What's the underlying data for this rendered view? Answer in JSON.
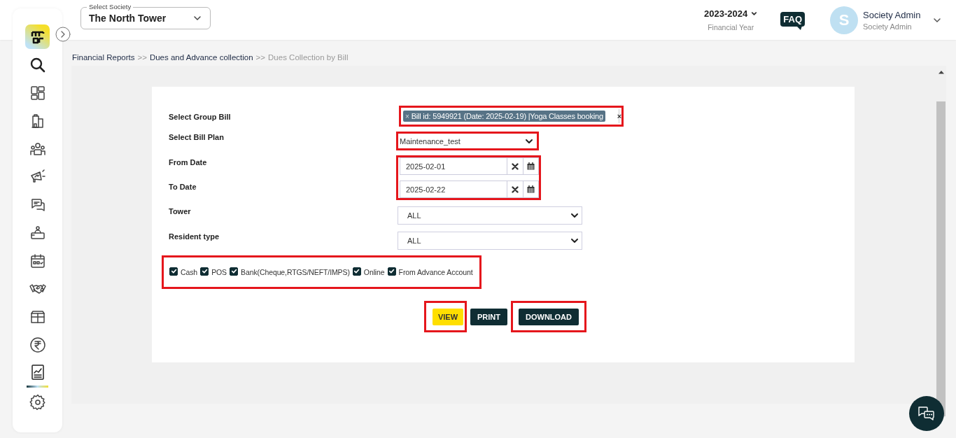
{
  "header": {
    "society_select": {
      "label": "Select Society",
      "value": "The North Tower"
    },
    "financial_year": {
      "value": "2023-2024",
      "caption": "Financial Year"
    },
    "faq": "FAQ",
    "user": {
      "initial": "S",
      "name": "Society Admin",
      "role": "Society Admin"
    }
  },
  "sidebar": {
    "items": [
      {
        "selected": false
      },
      {
        "selected": false
      },
      {
        "selected": false
      },
      {
        "selected": false
      },
      {
        "selected": false
      },
      {
        "selected": false
      },
      {
        "selected": false
      },
      {
        "selected": false
      },
      {
        "selected": false
      },
      {
        "selected": false
      },
      {
        "selected": false
      },
      {
        "selected": true
      },
      {
        "selected": false
      }
    ]
  },
  "breadcrumb": [
    {
      "label": "Financial Reports",
      "current": false
    },
    {
      "label": "Dues and Advance collection",
      "current": false
    },
    {
      "label": "Dues Collection by Bill",
      "current": true
    }
  ],
  "breadcrumb_separator": ">>",
  "form": {
    "fields": [
      {
        "kind": "tags",
        "label": "Select Group Bill",
        "tags": [
          {
            "remove": "×",
            "label": "Bill id: 5949921 (Date: 2025-02-19) |Yoga Classes booking"
          }
        ],
        "clear": "×",
        "highlighted": true
      },
      {
        "kind": "select",
        "label": "Select Bill Plan",
        "value": "Maintenance_test",
        "highlighted": true
      },
      {
        "kind": "daterange",
        "highlighted": true,
        "dates": [
          {
            "label": "From Date",
            "value": "2025-02-01"
          },
          {
            "label": "To Date",
            "value": "2025-02-22"
          }
        ]
      },
      {
        "kind": "select",
        "label": "Tower",
        "value": "ALL",
        "highlighted": false
      },
      {
        "kind": "select",
        "label": "Resident type",
        "value": "ALL",
        "highlighted": false
      }
    ],
    "payment_modes": {
      "highlighted": true,
      "options": [
        {
          "label": "Cash",
          "checked": true
        },
        {
          "label": "POS",
          "checked": true
        },
        {
          "label": "Bank(Cheque,RTGS/NEFT/IMPS)",
          "checked": true
        },
        {
          "label": "Online",
          "checked": true
        },
        {
          "label": "From Advance Account",
          "checked": true
        }
      ]
    },
    "buttons": [
      {
        "label": "VIEW",
        "kind": "primary",
        "highlighted": true
      },
      {
        "label": "PRINT",
        "kind": "dark",
        "highlighted": false
      },
      {
        "label": "DOWNLOAD",
        "kind": "dark",
        "highlighted": true
      }
    ]
  }
}
